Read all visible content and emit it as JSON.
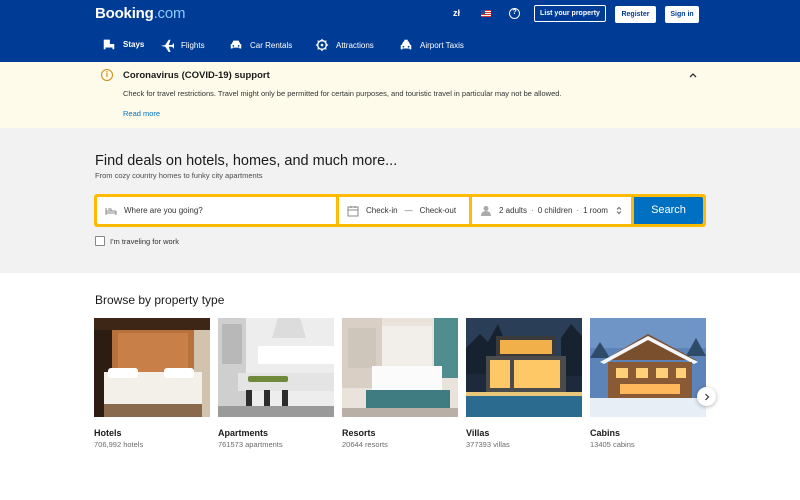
{
  "header": {
    "logo_main": "Booking",
    "logo_suffix": ".com",
    "currency": "zł",
    "list_property": "List your property",
    "register": "Register",
    "sign_in": "Sign in"
  },
  "nav": {
    "items": [
      {
        "label": "Stays",
        "icon": "bed-icon",
        "active": true
      },
      {
        "label": "Flights",
        "icon": "plane-icon"
      },
      {
        "label": "Car Rentals",
        "icon": "car-icon"
      },
      {
        "label": "Attractions",
        "icon": "attractions-icon"
      },
      {
        "label": "Airport Taxis",
        "icon": "taxi-icon"
      }
    ]
  },
  "alert": {
    "icon": "info-icon",
    "title": "Coronavirus (COVID-19) support",
    "text": "Check for travel restrictions. Travel might only be permitted for certain purposes, and touristic travel in particular may not be allowed.",
    "link": "Read more"
  },
  "hero": {
    "title": "Find deals on hotels, homes, and much more...",
    "subtitle": "From cozy country homes to funky city apartments"
  },
  "search": {
    "destination_placeholder": "Where are you going?",
    "check_in": "Check-in",
    "dash": "—",
    "check_out": "Check-out",
    "adults": "2 adults",
    "children": "0 children",
    "rooms": "1 room",
    "sep": "·",
    "button": "Search",
    "work_label": "I'm traveling for work"
  },
  "browse": {
    "title": "Browse by property type",
    "cards": [
      {
        "name": "Hotels",
        "count": "706,992 hotels"
      },
      {
        "name": "Apartments",
        "count": "761573 apartments"
      },
      {
        "name": "Resorts",
        "count": "20644 resorts"
      },
      {
        "name": "Villas",
        "count": "377393 villas"
      },
      {
        "name": "Cabins",
        "count": "13405 cabins"
      }
    ]
  },
  "colors": {
    "brand": "#003b95",
    "search_border": "#febb02",
    "search_button": "#0071c2",
    "alert_bg": "#fefbea"
  }
}
